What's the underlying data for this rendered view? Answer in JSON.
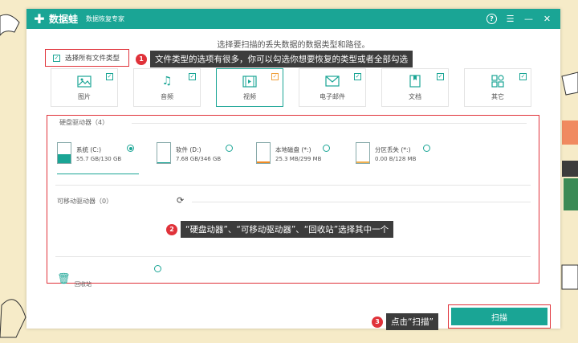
{
  "app": {
    "name": "数据蛙",
    "subtitle": "数据恢复专家",
    "logo_icon": "plus-logo-icon"
  },
  "titlebar_icons": [
    "help-icon",
    "menu-icon",
    "minimize-icon",
    "close-icon"
  ],
  "prompt": "选择要扫描的丢失数据的数据类型和路径。",
  "select_all": {
    "label": "选择所有文件类型",
    "checked": true
  },
  "annotations": [
    {
      "num": "1",
      "text": "文件类型的选项有很多，你可以勾选你想要恢复的类型或者全部勾选"
    },
    {
      "num": "2",
      "text": "“硬盘动器”、“可移动驱动器”、“回收站”选择其中一个"
    },
    {
      "num": "3",
      "text": "点击“扫描”"
    }
  ],
  "file_types": [
    {
      "label": "图片",
      "icon": "image-icon",
      "checked": true,
      "selected": false
    },
    {
      "label": "音频",
      "icon": "music-icon",
      "checked": true,
      "selected": false
    },
    {
      "label": "视频",
      "icon": "film-icon",
      "checked": true,
      "selected": true
    },
    {
      "label": "电子邮件",
      "icon": "envelope-icon",
      "checked": true,
      "selected": false
    },
    {
      "label": "文档",
      "icon": "document-icon",
      "checked": true,
      "selected": false
    },
    {
      "label": "其它",
      "icon": "grid-icon",
      "checked": true,
      "selected": false
    }
  ],
  "hard_drives": {
    "label": "硬盘驱动器（4）",
    "items": [
      {
        "name": "系统 (C:)",
        "size": "55.7 GB/130 GB",
        "selected": true,
        "fill_color": "#1aa595",
        "fill_fraction": 0.43
      },
      {
        "name": "软件 (D:)",
        "size": "7.68 GB/346 GB",
        "selected": false,
        "fill_color": "#1aa595",
        "fill_fraction": 0.03
      },
      {
        "name": "本地磁盘 (*:)",
        "size": "25.3 MB/299 MB",
        "selected": false,
        "fill_color": "#f08a24",
        "fill_fraction": 0.09
      },
      {
        "name": "分区丢失 (*:)",
        "size": "0.00 B/128 MB",
        "selected": false,
        "fill_color": "#f0b050",
        "fill_fraction": 0.0
      }
    ]
  },
  "removable": {
    "label": "可移动驱动器（0）",
    "icon": "refresh-icon"
  },
  "recycle": {
    "label": "回收站",
    "icon": "trash-icon",
    "selected": false
  },
  "scan_button": "扫描",
  "colors": {
    "accent": "#1aa595",
    "highlight": "#e0323a",
    "background": "#f6ebc8"
  }
}
